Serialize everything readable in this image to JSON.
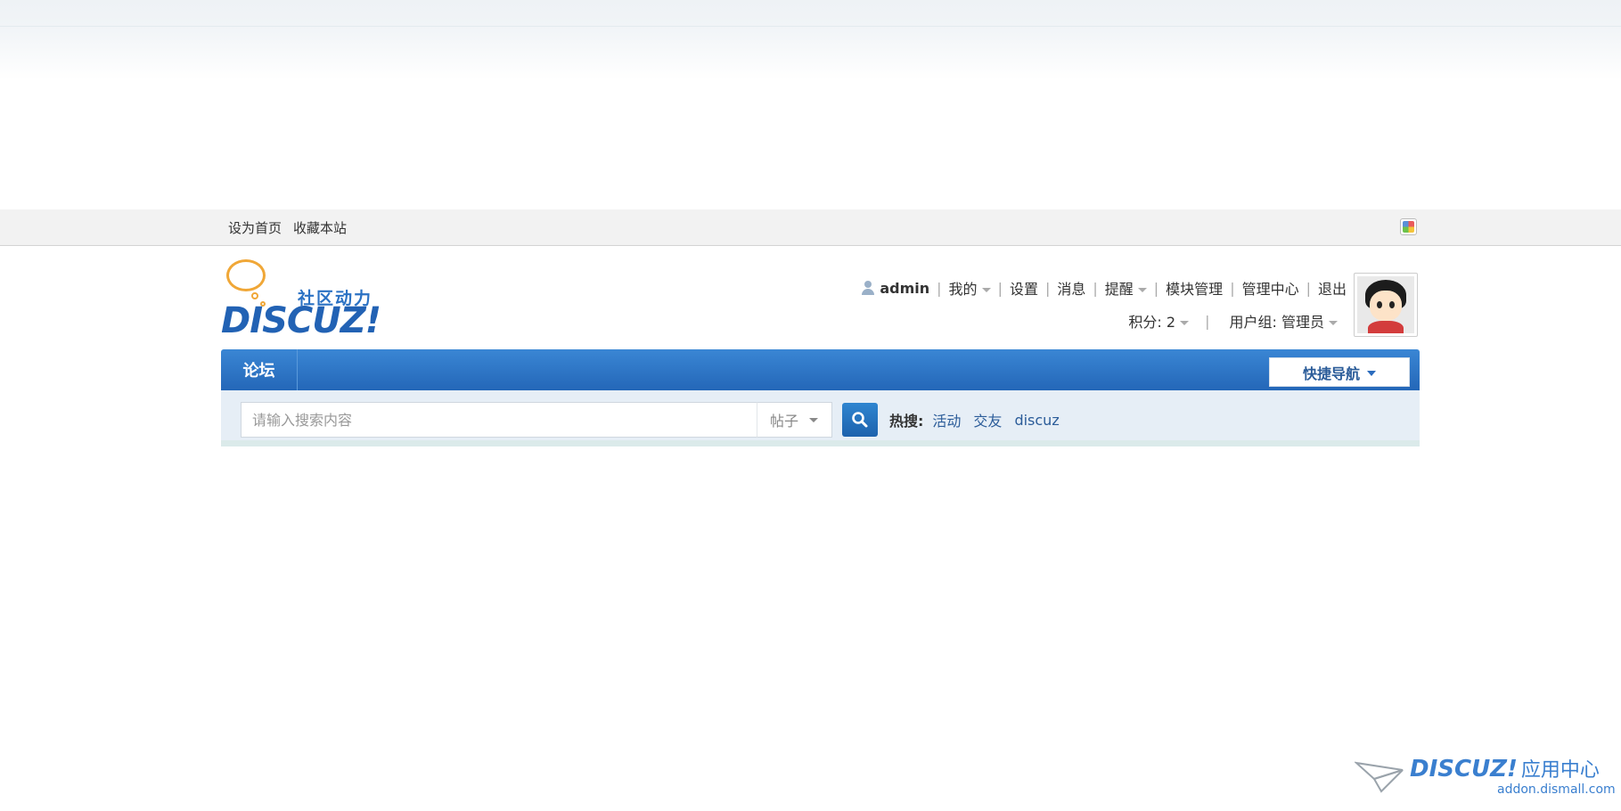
{
  "toolbar": {
    "set_homepage": "设为首页",
    "bookmark": "收藏本站"
  },
  "logo": {
    "tagline": "社区动力",
    "wordmark": "DISCUZ!"
  },
  "user": {
    "username": "admin",
    "my": "我的",
    "settings": "设置",
    "messages": "消息",
    "reminders": "提醒",
    "block_manage": "模块管理",
    "admin_center": "管理中心",
    "logout": "退出",
    "credits_label": "积分",
    "credits_value": "2",
    "usergroup_label": "用户组",
    "usergroup_value": "管理员"
  },
  "nav": {
    "forum": "论坛",
    "quick_nav": "快捷导航"
  },
  "search": {
    "placeholder": "请输入搜索内容",
    "type": "帖子",
    "hot_label": "热搜:",
    "hot_keywords": [
      "活动",
      "交友",
      "discuz"
    ]
  },
  "watermark": {
    "brand": "DISCUZ!",
    "brand_cn": "应用中心",
    "url": "addon.dismall.com"
  },
  "colors": {
    "nav_blue": "#2467b8",
    "link_blue": "#2b5c99",
    "logo_orange": "#f0a737"
  }
}
